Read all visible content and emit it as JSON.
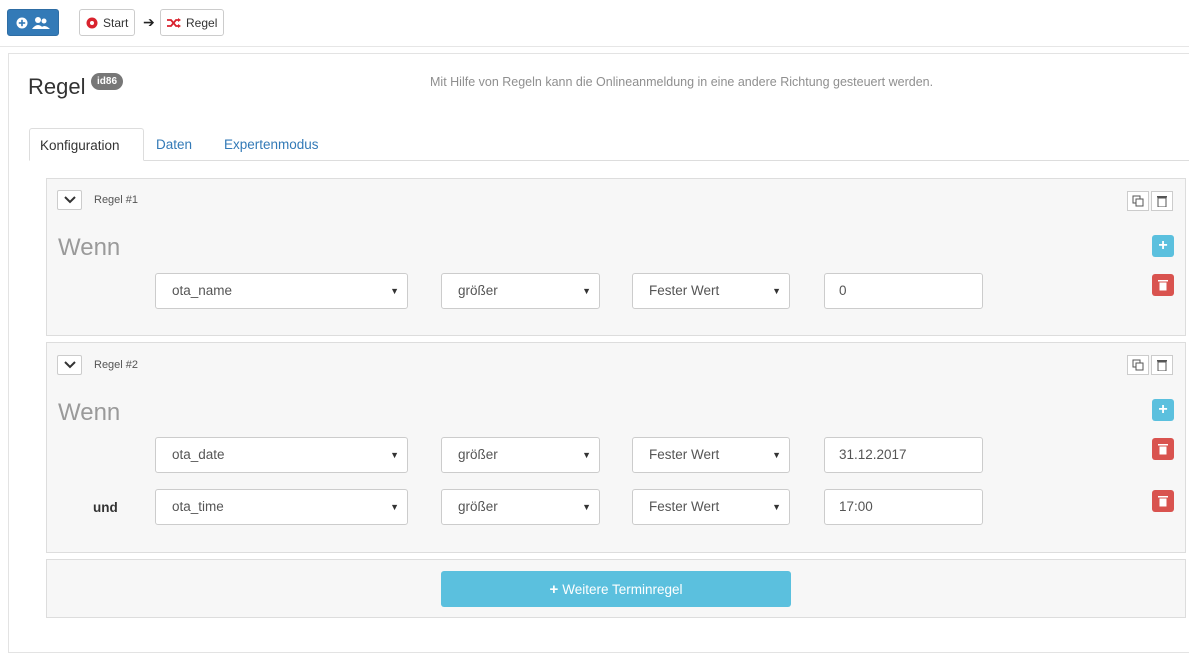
{
  "toolbar": {
    "crumb_start": "Start",
    "crumb_rule": "Regel"
  },
  "header": {
    "title": "Regel",
    "id_badge": "id86",
    "help_text": "Mit Hilfe von Regeln kann die Onlineanmeldung in eine andere Richtung gesteuert werden."
  },
  "tabs": [
    {
      "label": "Konfiguration",
      "active": true
    },
    {
      "label": "Daten",
      "active": false
    },
    {
      "label": "Expertenmodus",
      "active": false
    }
  ],
  "rules": [
    {
      "label": "Regel #1",
      "heading": "Wenn",
      "conditions": [
        {
          "prefix": "",
          "field": "ota_name",
          "operator": "größer",
          "type": "Fester Wert",
          "value": "0"
        }
      ]
    },
    {
      "label": "Regel #2",
      "heading": "Wenn",
      "conditions": [
        {
          "prefix": "",
          "field": "ota_date",
          "operator": "größer",
          "type": "Fester Wert",
          "value": "31.12.2017"
        },
        {
          "prefix": "und",
          "field": "ota_time",
          "operator": "größer",
          "type": "Fester Wert",
          "value": "17:00"
        }
      ]
    }
  ],
  "add_button_label": "Weitere Terminregel",
  "colors": {
    "primary": "#337ab7",
    "info": "#5bc0de",
    "danger": "#d9534f",
    "start_icon": "#d9232e",
    "rule_icon": "#d9232e"
  }
}
